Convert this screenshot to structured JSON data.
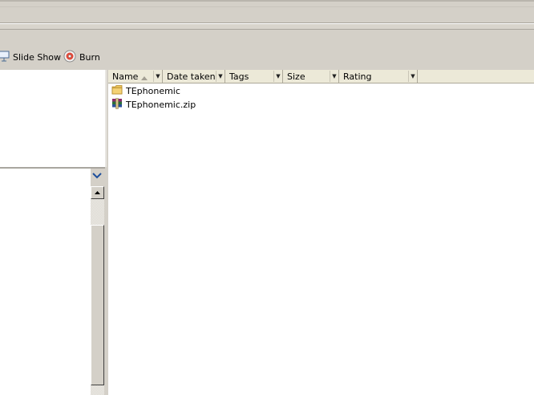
{
  "toolbar": {
    "slide_show_label": "Slide Show",
    "burn_label": "Burn"
  },
  "columns": [
    {
      "label": "Name",
      "sorted": "ascending"
    },
    {
      "label": "Date taken"
    },
    {
      "label": "Tags"
    },
    {
      "label": "Size"
    },
    {
      "label": "Rating"
    }
  ],
  "files": [
    {
      "name": "TEphonemic",
      "icon": "folder-icon"
    },
    {
      "name": "TEphonemic.zip",
      "icon": "winrar-archive-icon"
    }
  ],
  "colors": {
    "chrome": "#d4d0c8",
    "header": "#ece9d8",
    "accent": "#1c4e9c"
  }
}
